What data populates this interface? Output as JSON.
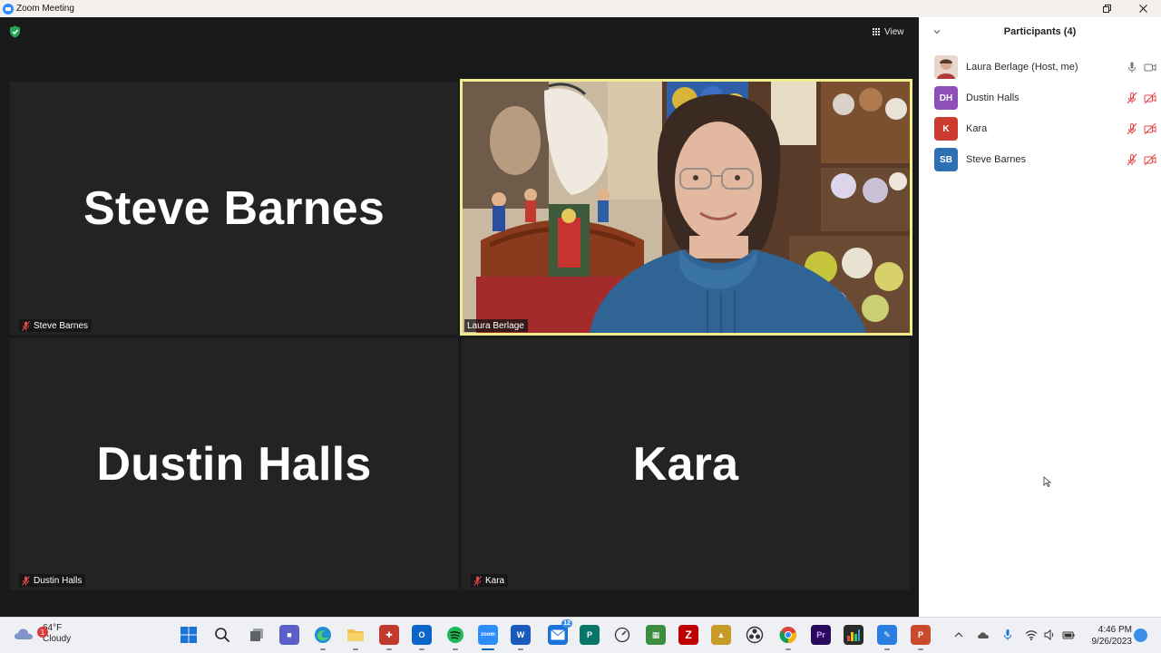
{
  "window": {
    "title": "Zoom Meeting"
  },
  "toolbar": {
    "view_label": "View"
  },
  "tiles": [
    {
      "big_name": "Steve Barnes",
      "tag": "Steve Barnes"
    },
    {
      "tag": "Laura Berlage"
    },
    {
      "big_name": "Dustin Halls",
      "tag": "Dustin Halls"
    },
    {
      "big_name": "Kara",
      "tag": "Kara"
    }
  ],
  "participants": {
    "header": "Participants (4)",
    "list": [
      {
        "initials": "",
        "name": "Laura Berlage (Host, me)",
        "color": "#b0645a",
        "mic": "on",
        "video": "on"
      },
      {
        "initials": "DH",
        "name": "Dustin Halls",
        "color": "#8e4fb8",
        "mic": "off",
        "video": "off"
      },
      {
        "initials": "K",
        "name": "Kara",
        "color": "#cc3b30",
        "mic": "off",
        "video": "off"
      },
      {
        "initials": "SB",
        "name": "Steve Barnes",
        "color": "#2f6fb3",
        "mic": "off",
        "video": "off"
      }
    ]
  },
  "taskbar": {
    "weather": {
      "temp": "64°F",
      "condition": "Cloudy",
      "badge": "1"
    },
    "clock": {
      "time": "4:46 PM",
      "date": "9/26/2023"
    },
    "apps": [
      {
        "name": "start-icon",
        "label": ""
      },
      {
        "name": "search-icon",
        "label": ""
      },
      {
        "name": "task-view-icon",
        "label": ""
      },
      {
        "name": "teams-icon",
        "label": ""
      },
      {
        "name": "edge-icon",
        "label": ""
      },
      {
        "name": "file-explorer-icon",
        "label": ""
      },
      {
        "name": "app-red-icon",
        "label": ""
      },
      {
        "name": "outlook-icon",
        "label": ""
      },
      {
        "name": "spotify-icon",
        "label": ""
      },
      {
        "name": "zoom-icon",
        "label": ""
      },
      {
        "name": "word-icon",
        "label": "W"
      },
      {
        "name": "mail-icon",
        "label": "12"
      },
      {
        "name": "publisher-icon",
        "label": "P"
      },
      {
        "name": "speedometer-icon",
        "label": ""
      },
      {
        "name": "app-green-icon",
        "label": ""
      },
      {
        "name": "filezilla-icon",
        "label": ""
      },
      {
        "name": "app-yellow-icon",
        "label": ""
      },
      {
        "name": "obs-icon",
        "label": ""
      },
      {
        "name": "chrome-icon",
        "label": ""
      },
      {
        "name": "premiere-icon",
        "label": "Pr"
      },
      {
        "name": "app-chart-icon",
        "label": ""
      },
      {
        "name": "app-blue-icon",
        "label": ""
      },
      {
        "name": "powerpoint-icon",
        "label": ""
      }
    ]
  },
  "colors": {
    "active_speaker_border": "#f1ed8c",
    "tile_bg": "#232323",
    "muted_red": "#e04848"
  }
}
